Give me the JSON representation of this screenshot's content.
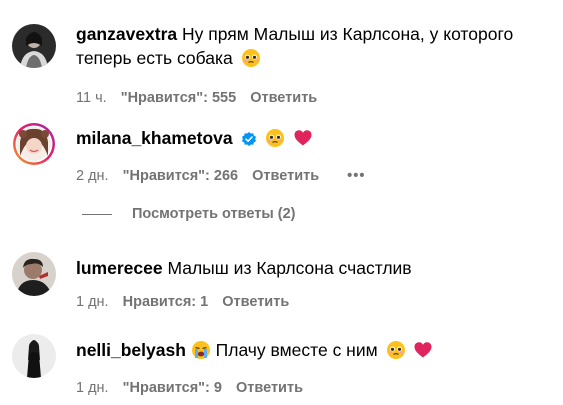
{
  "comments": [
    {
      "username": "ganzavextra",
      "text": "Ну прям Малыш из Карлсона, у которого теперь есть собака",
      "emoji": "pleading-face",
      "time": "11 ч.",
      "likes": "\"Нравится\": 555",
      "reply": "Ответить"
    },
    {
      "username": "milana_khametova",
      "verified": true,
      "text": "",
      "emoji": [
        "pleading-face",
        "red-heart"
      ],
      "time": "2 дн.",
      "likes": "\"Нравится\": 266",
      "reply": "Ответить",
      "more": "•••"
    },
    {
      "username": "lumerecee",
      "text": "Малыш из Карлсона счастлив",
      "time": "1 дн.",
      "likes": "Нравится: 1",
      "reply": "Ответить"
    },
    {
      "username": "nelli_belyash",
      "text": "Плачу вместе с ним",
      "emoji": [
        "crying-face",
        "pleading-face",
        "red-heart"
      ],
      "time": "1 дн.",
      "likes": "\"Нравится\": 9",
      "reply": "Ответить"
    }
  ],
  "view_replies": "Посмотреть ответы (2)",
  "colors": {
    "text": "#000000",
    "meta": "#737373",
    "verified": "#0095f6",
    "heart": "#e0245e"
  }
}
